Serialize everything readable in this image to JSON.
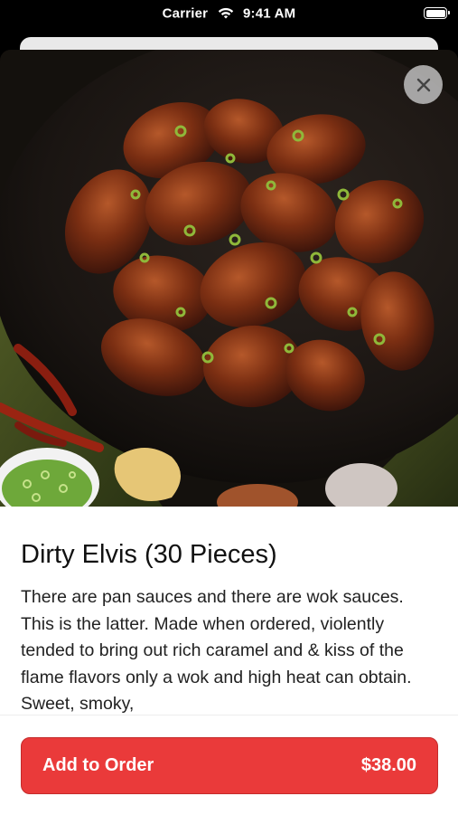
{
  "status_bar": {
    "carrier": "Carrier",
    "time": "9:41 AM",
    "wifi_icon": "wifi-icon",
    "battery_icon": "battery-full-icon"
  },
  "hero": {
    "image_subject": "wings-in-wok",
    "close_icon": "close-icon"
  },
  "item": {
    "title": "Dirty Elvis (30 Pieces)",
    "description": "There are pan sauces and there are wok sauces. This is the latter. Made when ordered, violently tended to bring out rich caramel and & kiss of the flame flavors only a wok and high heat can obtain. Sweet, smoky,"
  },
  "order_button": {
    "label": "Add to Order",
    "price": "$38.00"
  },
  "colors": {
    "accent": "#ea3a3a",
    "title_text": "#111111",
    "body_text": "#222222"
  }
}
